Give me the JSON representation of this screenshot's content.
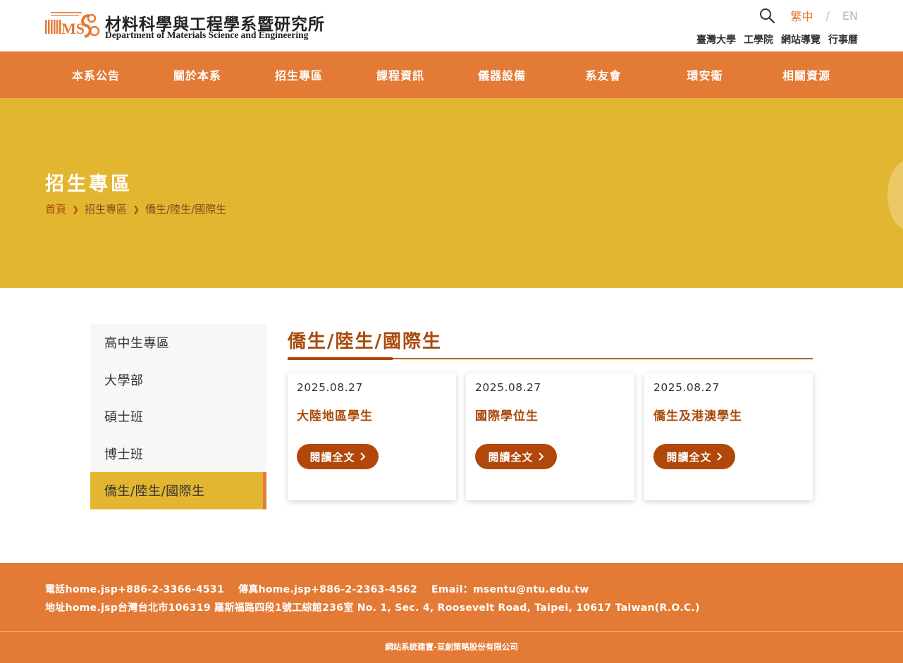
{
  "header": {
    "logo_title": "材料科學與工程學系暨研究所",
    "logo_subtitle": "Department of Materials Science and Engineering",
    "lang_zh": "繁中",
    "lang_sep": "/",
    "lang_en": "EN",
    "quick_links": [
      "臺灣大學",
      "工學院",
      "網站導覽",
      "行事曆"
    ]
  },
  "nav": [
    "本系公告",
    "關於本系",
    "招生專區",
    "課程資訊",
    "儀器設備",
    "系友會",
    "環安衛",
    "相關資源"
  ],
  "banner": {
    "title": "招生專區",
    "breadcrumb": [
      "首頁",
      "招生專區",
      "僑生/陸生/國際生"
    ]
  },
  "sidebar": {
    "items": [
      "高中生專區",
      "大學部",
      "碩士班",
      "博士班",
      "僑生/陸生/國際生"
    ],
    "active_index": 4
  },
  "section": {
    "title": "僑生/陸生/國際生"
  },
  "cards": [
    {
      "date": "2025.08.27",
      "title": "大陸地區學生",
      "button": "閱讀全文"
    },
    {
      "date": "2025.08.27",
      "title": "國際學位生",
      "button": "閱讀全文"
    },
    {
      "date": "2025.08.27",
      "title": "僑生及港澳學生",
      "button": "閱讀全文"
    }
  ],
  "footer": {
    "phone": "電話home.jsp+886-2-3366-4531",
    "fax": "傳真home.jsp+886-2-2363-4562",
    "email": "Email：msentu@ntu.edu.tw",
    "address": "地址home.jsp台灣台北市106319 羅斯福路四段1號工綜館236室 No. 1, Sec. 4, Roosevelt Road, Taipei, 10617 Taiwan(R.O.C.)",
    "copyright": "網站系統建置-亘創策略股份有限公司"
  },
  "colors": {
    "accent": "#e37a35",
    "banner": "#e3b632",
    "dark_orange": "#b2470a"
  }
}
